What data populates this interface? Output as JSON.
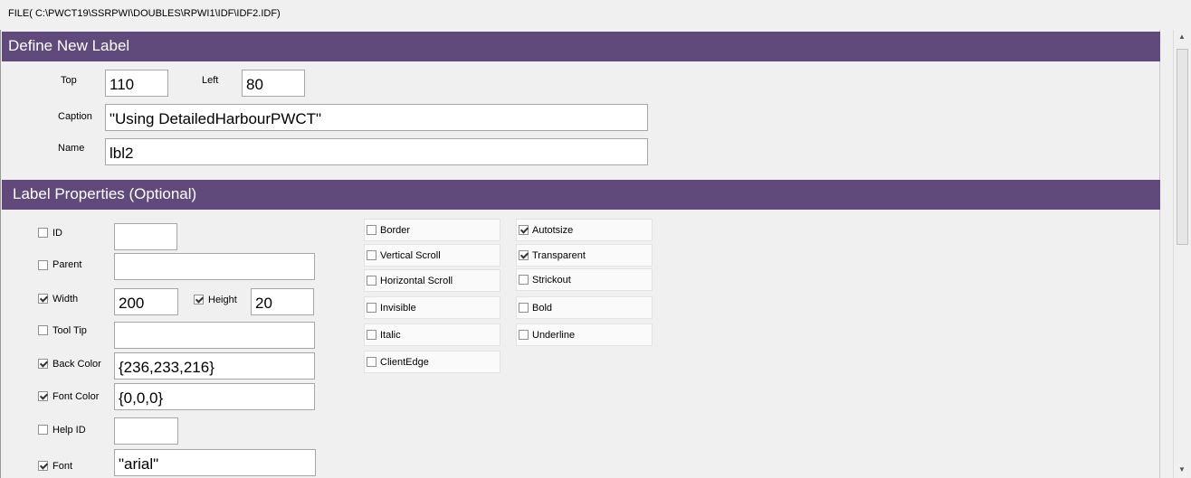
{
  "window": {
    "file_path": "FILE( C:\\PWCT19\\SSRPWI\\DOUBLES\\RPWI1\\IDF\\IDF2.IDF)"
  },
  "sections": {
    "define": "Define New  Label",
    "properties": "Label Properties (Optional)"
  },
  "fields": {
    "top": {
      "label": "Top",
      "value": "110"
    },
    "left": {
      "label": "Left",
      "value": "80"
    },
    "caption": {
      "label": "Caption",
      "value": "\"Using DetailedHarbourPWCT\""
    },
    "name": {
      "label": "Name",
      "value": "lbl2"
    }
  },
  "props": {
    "id": {
      "label": "ID",
      "checked": false,
      "value": ""
    },
    "parent": {
      "label": "Parent",
      "checked": false,
      "value": ""
    },
    "width": {
      "label": "Width",
      "checked": true,
      "value": "200"
    },
    "height": {
      "label": "Height",
      "checked": true,
      "value": "20"
    },
    "tooltip": {
      "label": "Tool Tip",
      "checked": false,
      "value": ""
    },
    "backcolor": {
      "label": "Back Color",
      "checked": true,
      "value": "{236,233,216}"
    },
    "fontcolor": {
      "label": "Font Color",
      "checked": true,
      "value": "{0,0,0}"
    },
    "helpid": {
      "label": "Help ID",
      "checked": false,
      "value": ""
    },
    "font": {
      "label": "Font",
      "checked": true,
      "value": "\"arial\""
    }
  },
  "flags": {
    "border": {
      "label": "Border",
      "checked": false
    },
    "vscroll": {
      "label": "Vertical Scroll",
      "checked": false
    },
    "hscroll": {
      "label": "Horizontal Scroll",
      "checked": false
    },
    "invisible": {
      "label": "Invisible",
      "checked": false
    },
    "italic": {
      "label": "Italic",
      "checked": false
    },
    "clientedge": {
      "label": "ClientEdge",
      "checked": false
    },
    "autosize": {
      "label": "Autotsize",
      "checked": true
    },
    "transparent": {
      "label": "Transparent",
      "checked": true
    },
    "strikeout": {
      "label": "Strickout",
      "checked": false
    },
    "bold": {
      "label": "Bold",
      "checked": false
    },
    "underline": {
      "label": "Underline",
      "checked": false
    }
  }
}
